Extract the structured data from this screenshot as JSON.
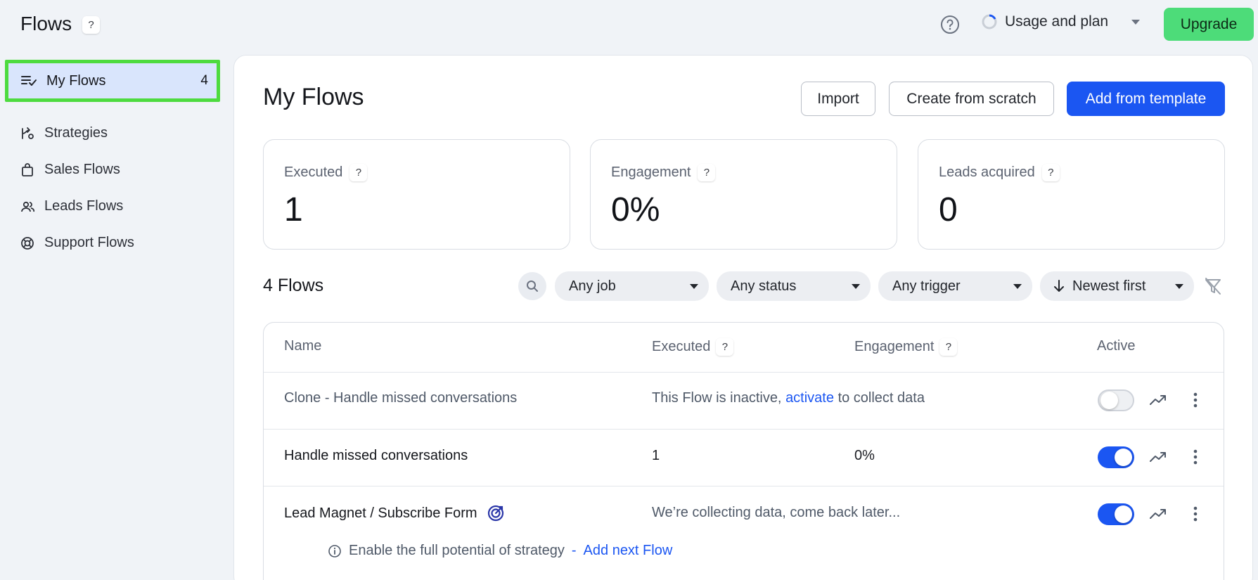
{
  "header": {
    "title": "Flows",
    "title_help": "?",
    "usage_label": "Usage and plan",
    "upgrade_label": "Upgrade"
  },
  "sidebar": {
    "active": {
      "label": "My Flows",
      "count": "4"
    },
    "items": [
      {
        "label": "Strategies",
        "icon": "strategy-icon"
      },
      {
        "label": "Sales Flows",
        "icon": "shopping-bag-icon"
      },
      {
        "label": "Leads Flows",
        "icon": "users-icon"
      },
      {
        "label": "Support Flows",
        "icon": "lifebuoy-icon"
      }
    ]
  },
  "main": {
    "title": "My Flows",
    "import_label": "Import",
    "create_label": "Create from scratch",
    "template_label": "Add from template"
  },
  "stats": [
    {
      "label": "Executed",
      "help": "?",
      "value": "1"
    },
    {
      "label": "Engagement",
      "help": "?",
      "value": "0%"
    },
    {
      "label": "Leads acquired",
      "help": "?",
      "value": "0"
    }
  ],
  "list": {
    "count_label": "4 Flows",
    "filters": {
      "job": "Any job",
      "status": "Any status",
      "trigger": "Any trigger",
      "sort": "Newest first"
    }
  },
  "table": {
    "headers": {
      "name": "Name",
      "executed": "Executed",
      "engagement": "Engagement",
      "active": "Active",
      "help": "?"
    },
    "rows": [
      {
        "name": "Clone - Handle missed conversations",
        "inactive_prefix": "This Flow is inactive,",
        "inactive_link": "activate",
        "inactive_suffix": "to collect data",
        "active": false
      },
      {
        "name": "Handle missed conversations",
        "executed": "1",
        "engagement": "0%",
        "active": true
      },
      {
        "name": "Lead Magnet / Subscribe Form",
        "collecting": "We’re collecting data, come back later...",
        "hint_text": "Enable the full potential of strategy",
        "hint_sep": "-",
        "hint_link": "Add next Flow",
        "active": true
      }
    ]
  },
  "colors": {
    "primary": "#1b56f2",
    "upgrade": "#4ddc79",
    "highlight_border": "#4ddb3f",
    "active_bg": "#d9e5fc"
  }
}
